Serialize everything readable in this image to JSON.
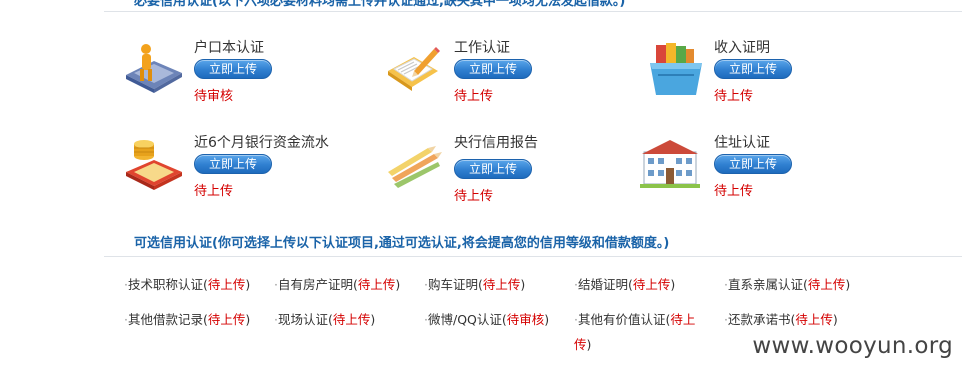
{
  "header": {
    "required_note_partial": "必要信用认证(以下六项必要材料均需上传并认证通过,缺失其中一项均无法发起借款。)"
  },
  "required": [
    {
      "name": "户口本认证",
      "button": "立即上传",
      "status": "待审核",
      "icon": "id-book-icon"
    },
    {
      "name": "工作认证",
      "button": "立即上传",
      "status": "待上传",
      "icon": "notepad-pencil-icon"
    },
    {
      "name": "收入证明",
      "button": "立即上传",
      "status": "待上传",
      "icon": "documents-box-icon"
    },
    {
      "name": "近6个月银行资金流水",
      "button": "立即上传",
      "status": "待上传",
      "icon": "coins-stack-icon"
    },
    {
      "name": "央行信用报告",
      "button": "立即上传",
      "status": "待上传",
      "icon": "pencils-icon"
    },
    {
      "name": "住址认证",
      "button": "立即上传",
      "status": "待上传",
      "icon": "building-icon"
    }
  ],
  "optional": {
    "title": "可选信用认证(你可选择上传以下认证项目,通过可选认证,将会提高您的信用等级和借款额度。)",
    "items": [
      {
        "name": "技术职称认证",
        "status": "待上传"
      },
      {
        "name": "自有房产证明",
        "status": "待上传"
      },
      {
        "name": "购车证明",
        "status": "待上传"
      },
      {
        "name": "结婚证明",
        "status": "待上传"
      },
      {
        "name": "直系亲属认证",
        "status": "待上传"
      },
      {
        "name": "其他借款记录",
        "status": "待上传"
      },
      {
        "name": "现场认证",
        "status": "待上传"
      },
      {
        "name": "微博/QQ认证",
        "status": "待审核"
      },
      {
        "name": "其他有价值认证",
        "status": "待上传"
      },
      {
        "name": "还款承诺书",
        "status": "待上传"
      }
    ]
  },
  "watermark": "www.wooyun.org",
  "colors": {
    "status_red": "#d40000",
    "title_blue": "#1a63a8",
    "button_blue": "#2f7fd0"
  }
}
